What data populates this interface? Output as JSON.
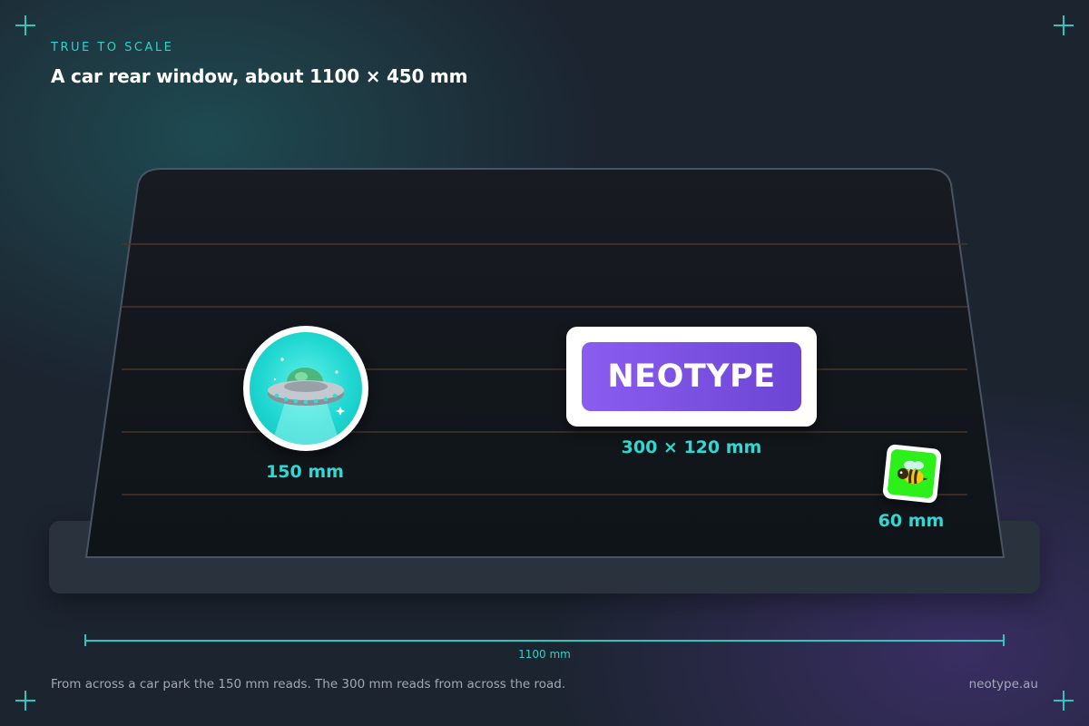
{
  "eyebrow": "TRUE TO SCALE",
  "headline": "A car rear window, about 1100 × 450 mm",
  "stickers": {
    "ufo": {
      "size_label": "150 mm",
      "icon": "ufo-icon",
      "color": "#1fd6d0"
    },
    "plate": {
      "text": "NEOTYPE",
      "size_label": "300 × 120 mm",
      "color": "#7a50e2"
    },
    "bee": {
      "size_label": "60 mm",
      "icon": "bee-icon",
      "color": "#2df01a"
    }
  },
  "dimension": {
    "label": "1100 mm"
  },
  "footer": {
    "caption": "From across a car park the 150 mm reads. The 300 mm reads from across the road.",
    "site": "neotype.au"
  },
  "colors": {
    "accent": "#2ed1cb",
    "window_glass": "#111820",
    "defroster_lines": "#4a3528"
  }
}
